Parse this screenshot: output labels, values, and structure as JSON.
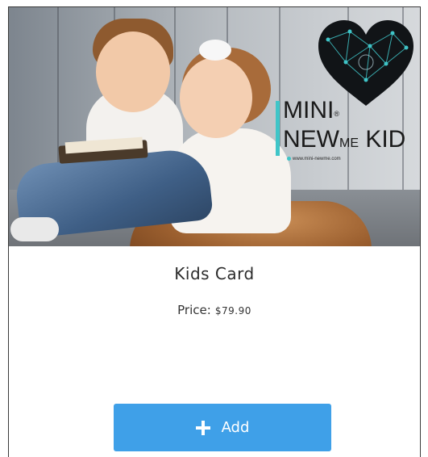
{
  "product": {
    "title": "Kids Card",
    "price_label": "Price:",
    "price_value": "$79.90"
  },
  "image": {
    "brand_line1": "MINI",
    "brand_registered": "®",
    "brand_line2_a": "NEW",
    "brand_line2_b": "ME",
    "brand_line2_c": " KID",
    "brand_url": "www.mini-newme.com"
  },
  "actions": {
    "add_label": "Add",
    "add_icon": "plus-icon"
  },
  "colors": {
    "accent": "#3fa0e8",
    "brand_teal": "#3fc5c8",
    "text": "#2b2b2b"
  }
}
